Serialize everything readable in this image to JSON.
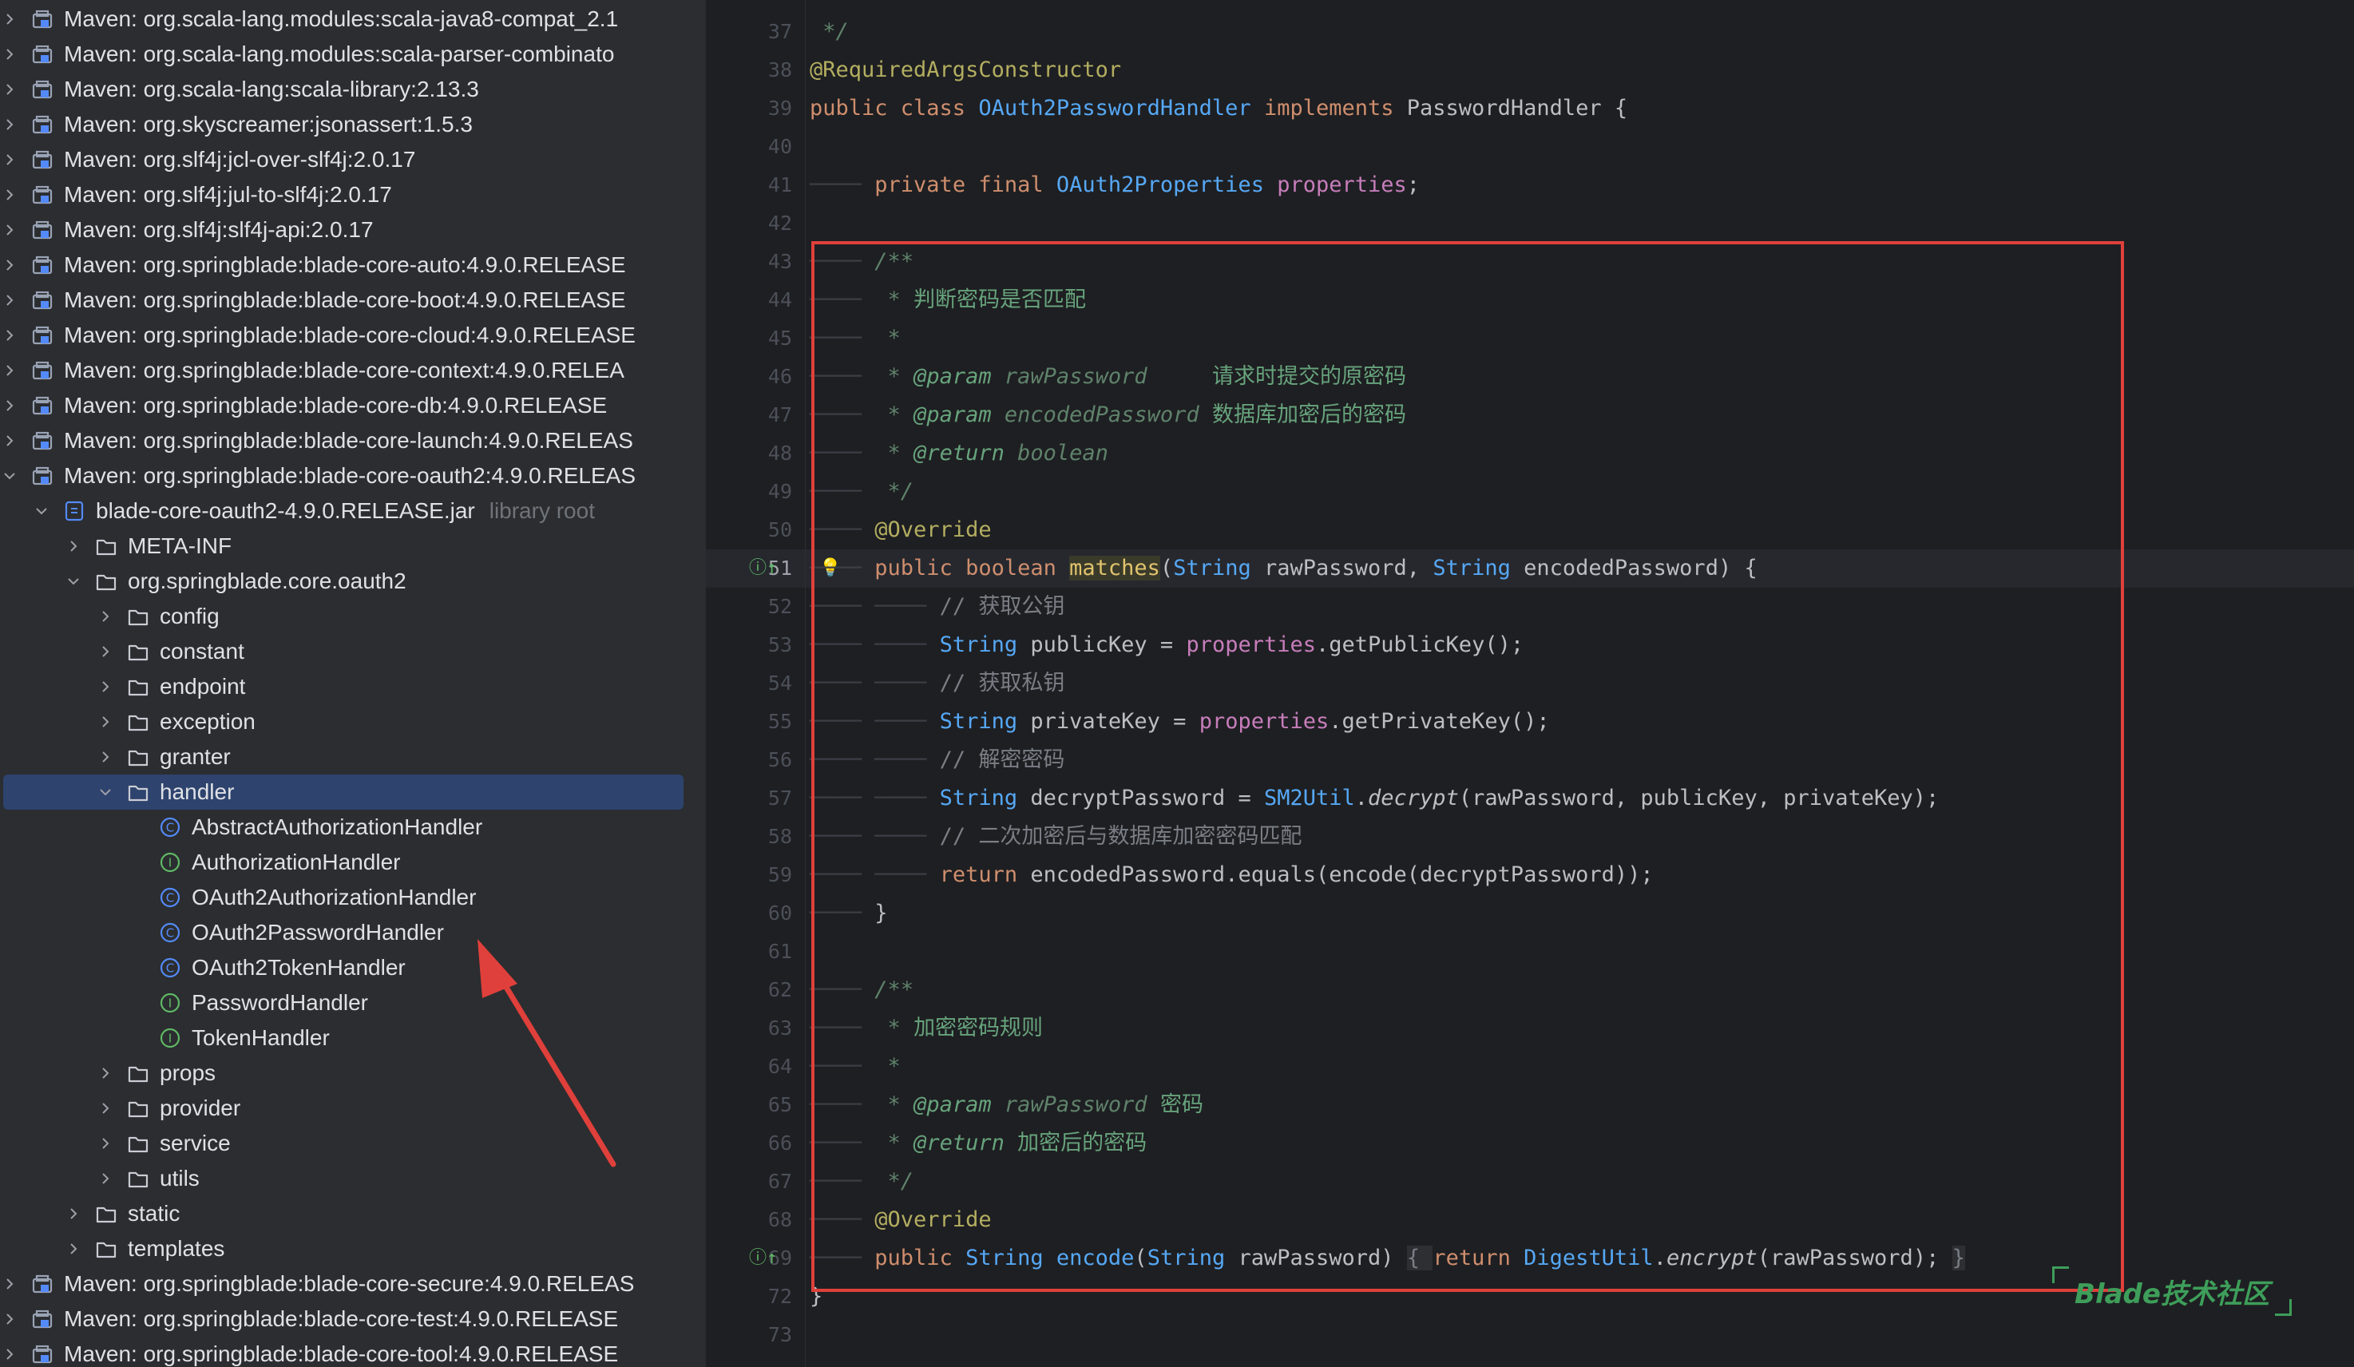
{
  "colors": {
    "selection": "#2e436e",
    "annotation_red": "#e0403b",
    "watermark_green": "#3e9e5a"
  },
  "tree": {
    "items": [
      {
        "label": "Maven: org.scala-lang.modules:scala-java8-compat_2.1",
        "depth": 0,
        "expanded": false,
        "icon": "library-icon"
      },
      {
        "label": "Maven: org.scala-lang.modules:scala-parser-combinato",
        "depth": 0,
        "expanded": false,
        "icon": "library-icon"
      },
      {
        "label": "Maven: org.scala-lang:scala-library:2.13.3",
        "depth": 0,
        "expanded": false,
        "icon": "library-icon"
      },
      {
        "label": "Maven: org.skyscreamer:jsonassert:1.5.3",
        "depth": 0,
        "expanded": false,
        "icon": "library-icon"
      },
      {
        "label": "Maven: org.slf4j:jcl-over-slf4j:2.0.17",
        "depth": 0,
        "expanded": false,
        "icon": "library-icon"
      },
      {
        "label": "Maven: org.slf4j:jul-to-slf4j:2.0.17",
        "depth": 0,
        "expanded": false,
        "icon": "library-icon"
      },
      {
        "label": "Maven: org.slf4j:slf4j-api:2.0.17",
        "depth": 0,
        "expanded": false,
        "icon": "library-icon"
      },
      {
        "label": "Maven: org.springblade:blade-core-auto:4.9.0.RELEASE",
        "depth": 0,
        "expanded": false,
        "icon": "library-icon"
      },
      {
        "label": "Maven: org.springblade:blade-core-boot:4.9.0.RELEASE",
        "depth": 0,
        "expanded": false,
        "icon": "library-icon"
      },
      {
        "label": "Maven: org.springblade:blade-core-cloud:4.9.0.RELEASE",
        "depth": 0,
        "expanded": false,
        "icon": "library-icon"
      },
      {
        "label": "Maven: org.springblade:blade-core-context:4.9.0.RELEA",
        "depth": 0,
        "expanded": false,
        "icon": "library-icon"
      },
      {
        "label": "Maven: org.springblade:blade-core-db:4.9.0.RELEASE",
        "depth": 0,
        "expanded": false,
        "icon": "library-icon"
      },
      {
        "label": "Maven: org.springblade:blade-core-launch:4.9.0.RELEAS",
        "depth": 0,
        "expanded": false,
        "icon": "library-icon"
      },
      {
        "label": "Maven: org.springblade:blade-core-oauth2:4.9.0.RELEAS",
        "depth": 0,
        "expanded": true,
        "icon": "library-icon"
      },
      {
        "label": "blade-core-oauth2-4.9.0.RELEASE.jar",
        "sub": "library root",
        "depth": 1,
        "expanded": true,
        "icon": "jar-icon"
      },
      {
        "label": "META-INF",
        "depth": 2,
        "expanded": false,
        "icon": "folder-icon"
      },
      {
        "label": "org.springblade.core.oauth2",
        "depth": 2,
        "expanded": true,
        "icon": "folder-icon"
      },
      {
        "label": "config",
        "depth": 3,
        "expanded": false,
        "icon": "folder-icon"
      },
      {
        "label": "constant",
        "depth": 3,
        "expanded": false,
        "icon": "folder-icon"
      },
      {
        "label": "endpoint",
        "depth": 3,
        "expanded": false,
        "icon": "folder-icon"
      },
      {
        "label": "exception",
        "depth": 3,
        "expanded": false,
        "icon": "folder-icon"
      },
      {
        "label": "granter",
        "depth": 3,
        "expanded": false,
        "icon": "folder-icon"
      },
      {
        "label": "handler",
        "depth": 3,
        "expanded": true,
        "icon": "folder-icon",
        "selected": true
      },
      {
        "label": "AbstractAuthorizationHandler",
        "depth": 4,
        "leaf": true,
        "icon": "class-icon"
      },
      {
        "label": "AuthorizationHandler",
        "depth": 4,
        "leaf": true,
        "icon": "interface-icon"
      },
      {
        "label": "OAuth2AuthorizationHandler",
        "depth": 4,
        "leaf": true,
        "icon": "class-icon"
      },
      {
        "label": "OAuth2PasswordHandler",
        "depth": 4,
        "leaf": true,
        "icon": "class-icon"
      },
      {
        "label": "OAuth2TokenHandler",
        "depth": 4,
        "leaf": true,
        "icon": "class-icon"
      },
      {
        "label": "PasswordHandler",
        "depth": 4,
        "leaf": true,
        "icon": "interface-icon"
      },
      {
        "label": "TokenHandler",
        "depth": 4,
        "leaf": true,
        "icon": "interface-icon"
      },
      {
        "label": "props",
        "depth": 3,
        "expanded": false,
        "icon": "folder-icon"
      },
      {
        "label": "provider",
        "depth": 3,
        "expanded": false,
        "icon": "folder-icon"
      },
      {
        "label": "service",
        "depth": 3,
        "expanded": false,
        "icon": "folder-icon"
      },
      {
        "label": "utils",
        "depth": 3,
        "expanded": false,
        "icon": "folder-icon"
      },
      {
        "label": "static",
        "depth": 2,
        "expanded": false,
        "icon": "folder-icon"
      },
      {
        "label": "templates",
        "depth": 2,
        "expanded": false,
        "icon": "folder-icon"
      },
      {
        "label": "Maven: org.springblade:blade-core-secure:4.9.0.RELEAS",
        "depth": 0,
        "expanded": false,
        "icon": "library-icon"
      },
      {
        "label": "Maven: org.springblade:blade-core-test:4.9.0.RELEASE",
        "depth": 0,
        "expanded": false,
        "icon": "library-icon"
      },
      {
        "label": "Maven: org.springblade:blade-core-tool:4.9.0.RELEASE",
        "depth": 0,
        "expanded": false,
        "icon": "library-icon"
      }
    ]
  },
  "editor": {
    "current_line": "51",
    "lines": [
      {
        "n": "37",
        "i": 0,
        "t": [
          [
            " */",
            "doc"
          ]
        ]
      },
      {
        "n": "38",
        "i": 0,
        "t": [
          [
            "@RequiredArgsConstructor",
            "ann"
          ]
        ]
      },
      {
        "n": "39",
        "i": 0,
        "t": [
          [
            "public class ",
            "kw"
          ],
          [
            "OAuth2PasswordHandler",
            "ty"
          ],
          [
            " implements ",
            "kw"
          ],
          [
            "PasswordHandler",
            "plain"
          ],
          [
            " {",
            "plain"
          ]
        ]
      },
      {
        "n": "40",
        "i": 0,
        "t": []
      },
      {
        "n": "41",
        "i": 1,
        "t": [
          [
            "private final ",
            "kw"
          ],
          [
            "OAuth2Properties",
            "ty"
          ],
          [
            " properties",
            "fld"
          ],
          [
            ";",
            "plain"
          ]
        ]
      },
      {
        "n": "42",
        "i": 0,
        "t": []
      },
      {
        "n": "43",
        "i": 1,
        "t": [
          [
            "/**",
            "doc"
          ]
        ]
      },
      {
        "n": "44",
        "i": 1,
        "t": [
          [
            " * ",
            "doc"
          ],
          [
            "判断密码是否匹配",
            "docz"
          ]
        ]
      },
      {
        "n": "45",
        "i": 1,
        "t": [
          [
            " *",
            "doc"
          ]
        ]
      },
      {
        "n": "46",
        "i": 1,
        "t": [
          [
            " * ",
            "doc"
          ],
          [
            "@param",
            "doctag"
          ],
          [
            " rawPassword",
            "doc"
          ],
          [
            "     请求时提交的原密码",
            "docz"
          ]
        ]
      },
      {
        "n": "47",
        "i": 1,
        "t": [
          [
            " * ",
            "doc"
          ],
          [
            "@param",
            "doctag"
          ],
          [
            " encodedPassword",
            "doc"
          ],
          [
            " 数据库加密后的密码",
            "docz"
          ]
        ]
      },
      {
        "n": "48",
        "i": 1,
        "t": [
          [
            " * ",
            "doc"
          ],
          [
            "@return",
            "doctag"
          ],
          [
            " boolean",
            "doc"
          ]
        ]
      },
      {
        "n": "49",
        "i": 1,
        "t": [
          [
            " */",
            "doc"
          ]
        ]
      },
      {
        "n": "50",
        "i": 1,
        "t": [
          [
            "@Override",
            "ann"
          ]
        ]
      },
      {
        "n": "51",
        "i": 1,
        "t": [
          [
            "public boolean ",
            "kw"
          ],
          [
            "matches",
            "fnm"
          ],
          [
            "(",
            "plain"
          ],
          [
            "String",
            "ty"
          ],
          [
            " rawPassword, ",
            "plain"
          ],
          [
            "String",
            "ty"
          ],
          [
            " encodedPassword) {",
            "plain"
          ]
        ]
      },
      {
        "n": "52",
        "i": 2,
        "t": [
          [
            "// 获取公钥",
            "cm"
          ]
        ]
      },
      {
        "n": "53",
        "i": 2,
        "t": [
          [
            "String",
            "ty"
          ],
          [
            " publicKey = ",
            "plain"
          ],
          [
            "properties",
            "fld"
          ],
          [
            ".getPublicKey();",
            "plain"
          ]
        ]
      },
      {
        "n": "54",
        "i": 2,
        "t": [
          [
            "// 获取私钥",
            "cm"
          ]
        ]
      },
      {
        "n": "55",
        "i": 2,
        "t": [
          [
            "String",
            "ty"
          ],
          [
            " privateKey = ",
            "plain"
          ],
          [
            "properties",
            "fld"
          ],
          [
            ".getPrivateKey();",
            "plain"
          ]
        ]
      },
      {
        "n": "56",
        "i": 2,
        "t": [
          [
            "// 解密密码",
            "cm"
          ]
        ]
      },
      {
        "n": "57",
        "i": 2,
        "t": [
          [
            "String",
            "ty"
          ],
          [
            " decryptPassword = ",
            "plain"
          ],
          [
            "SM2Util",
            "ty"
          ],
          [
            ".",
            "plain"
          ],
          [
            "decrypt",
            "st"
          ],
          [
            "(rawPassword, publicKey, privateKey);",
            "plain"
          ]
        ]
      },
      {
        "n": "58",
        "i": 2,
        "t": [
          [
            "// 二次加密后与数据库加密密码匹配",
            "cm"
          ]
        ]
      },
      {
        "n": "59",
        "i": 2,
        "t": [
          [
            "return ",
            "kw"
          ],
          [
            "encodedPassword.equals(encode(decryptPassword));",
            "plain"
          ]
        ]
      },
      {
        "n": "60",
        "i": 1,
        "t": [
          [
            "}",
            "plain"
          ]
        ]
      },
      {
        "n": "61",
        "i": 0,
        "t": []
      },
      {
        "n": "62",
        "i": 1,
        "t": [
          [
            "/**",
            "doc"
          ]
        ]
      },
      {
        "n": "63",
        "i": 1,
        "t": [
          [
            " * ",
            "doc"
          ],
          [
            "加密密码规则",
            "docz"
          ]
        ]
      },
      {
        "n": "64",
        "i": 1,
        "t": [
          [
            " *",
            "doc"
          ]
        ]
      },
      {
        "n": "65",
        "i": 1,
        "t": [
          [
            " * ",
            "doc"
          ],
          [
            "@param",
            "doctag"
          ],
          [
            " rawPassword",
            "doc"
          ],
          [
            " 密码",
            "docz"
          ]
        ]
      },
      {
        "n": "66",
        "i": 1,
        "t": [
          [
            " * ",
            "doc"
          ],
          [
            "@return",
            "doctag"
          ],
          [
            " 加密后的密码",
            "docz"
          ]
        ]
      },
      {
        "n": "67",
        "i": 1,
        "t": [
          [
            " */",
            "doc"
          ]
        ]
      },
      {
        "n": "68",
        "i": 1,
        "t": [
          [
            "@Override",
            "ann"
          ]
        ]
      },
      {
        "n": "69",
        "i": 1,
        "t": [
          [
            "public ",
            "kw"
          ],
          [
            "String",
            "ty"
          ],
          [
            " encode",
            "fn"
          ],
          [
            "(",
            "plain"
          ],
          [
            "String",
            "ty"
          ],
          [
            " rawPassword) ",
            "plain"
          ],
          [
            "{ ",
            "fold"
          ],
          [
            "return ",
            "kw"
          ],
          [
            "DigestUtil",
            "ty"
          ],
          [
            ".",
            "plain"
          ],
          [
            "encrypt",
            "st"
          ],
          [
            "(rawPassword); ",
            "plain"
          ],
          [
            "}",
            "fold"
          ]
        ]
      },
      {
        "n": "72",
        "i": 0,
        "t": [
          [
            "}",
            "plain"
          ]
        ]
      },
      {
        "n": "73",
        "i": 0,
        "t": []
      }
    ]
  },
  "watermark": {
    "text": "Blade技术社区"
  }
}
